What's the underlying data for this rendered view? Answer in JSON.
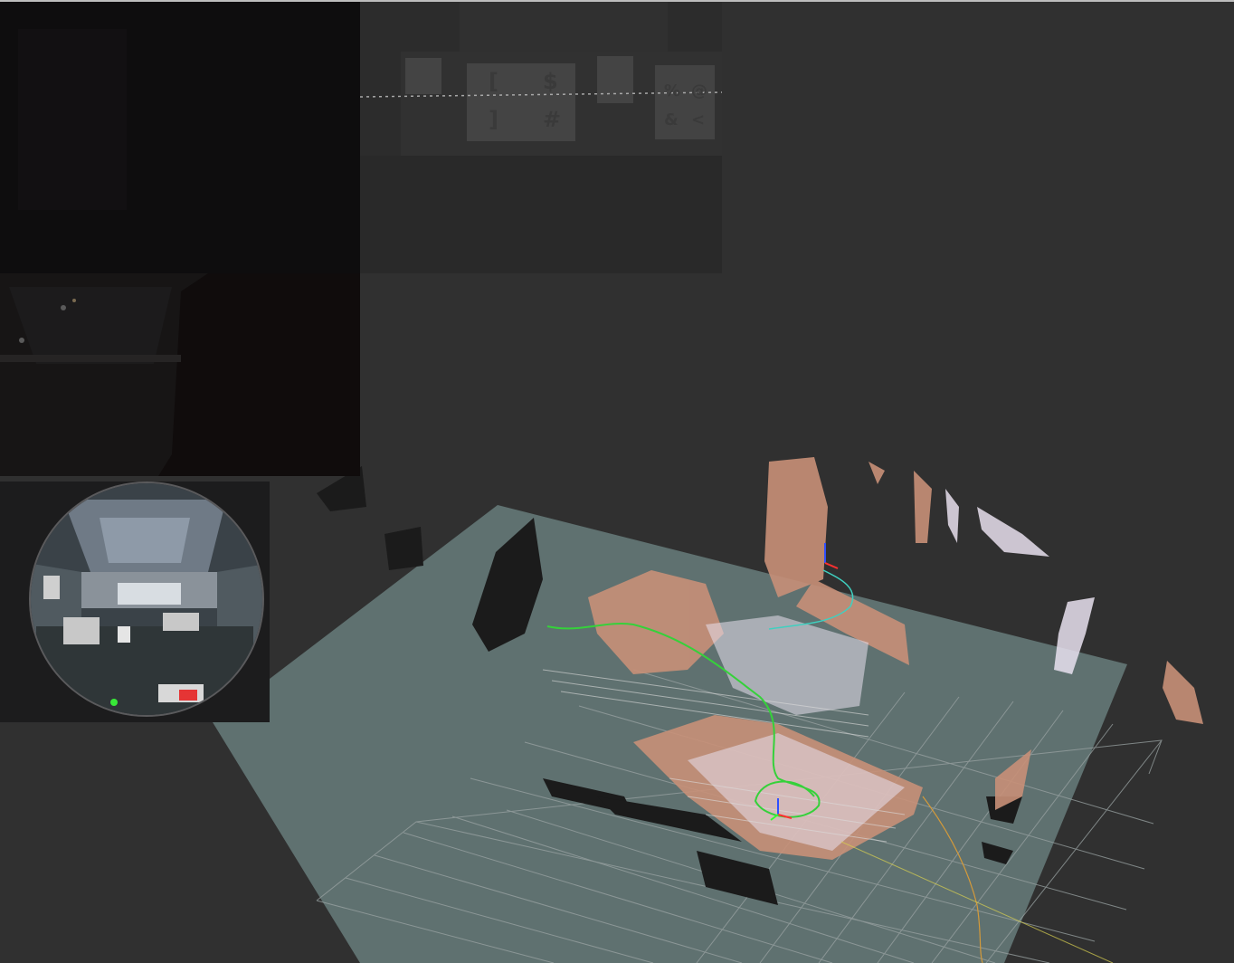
{
  "window": {
    "title": ""
  },
  "camera_views": {
    "top_left": {
      "description_icon": "dark-camera-icon"
    },
    "top_middle": {
      "marker_labels": [
        "[",
        "$",
        "]",
        "#",
        "%",
        "@",
        "&",
        "<"
      ]
    },
    "middle_left": {
      "description_icon": "ceiling-camera-icon"
    },
    "fisheye": {
      "description_icon": "fisheye-camera-icon"
    }
  },
  "colors": {
    "background": "#303030",
    "ground_plane": "#5f7170",
    "grid_lines": "#9aa3a3",
    "trajectory_green": "#35d13a",
    "trajectory_cyan": "#3fd0c0",
    "trajectory_orange": "#d49a3a",
    "pointcloud_main": "#c89078",
    "pointcloud_dark": "#1b1b1b",
    "pointcloud_light": "#e8e0ee"
  }
}
